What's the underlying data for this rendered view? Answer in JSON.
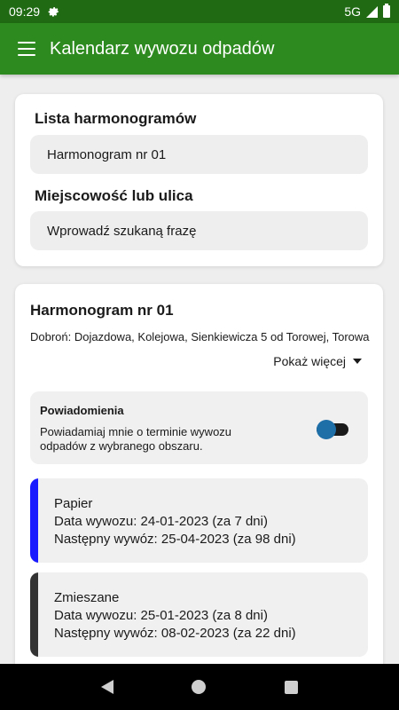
{
  "status": {
    "time": "09:29",
    "network": "5G",
    "gear_icon": "gear-icon",
    "signal_icon": "signal-icon",
    "battery_icon": "battery-icon"
  },
  "app_bar": {
    "title": "Kalendarz wywozu odpadów",
    "menu_icon": "menu-icon"
  },
  "search": {
    "schedule_list_label": "Lista harmonogramów",
    "schedule_value": "Harmonogram nr 01",
    "location_label": "Miejscowość lub ulica",
    "location_placeholder": "Wprowadź szukaną frazę"
  },
  "schedule": {
    "title": "Harmonogram nr 01",
    "description": "Dobroń: Dojazdowa, Kolejowa, Sienkiewicza 5 od Torowej, Torowa",
    "show_more": "Pokaż więcej",
    "notifications": {
      "title": "Powiadomienia",
      "description": "Powiadamiaj mnie o terminie wywozu odpadów z wybranego obszaru.",
      "enabled": true
    },
    "waste_types": [
      {
        "name": "Papier",
        "date_line": "Data wywozu: 24-01-2023 (za 7 dni)",
        "next_line": "Następny wywóz: 25-04-2023 (za 98 dni)",
        "color": "#1a1aff"
      },
      {
        "name": "Zmieszane",
        "date_line": "Data wywozu: 25-01-2023 (za 8 dni)",
        "next_line": "Następny wywóz: 08-02-2023 (za 22 dni)",
        "color": "#333333"
      }
    ]
  },
  "colors": {
    "status_bar": "#1f6a13",
    "app_bar": "#2d8a1e",
    "toggle_knob": "#1e6fa8"
  },
  "nav": {
    "back_icon": "back-icon",
    "home_icon": "home-icon",
    "recents_icon": "recents-icon"
  }
}
